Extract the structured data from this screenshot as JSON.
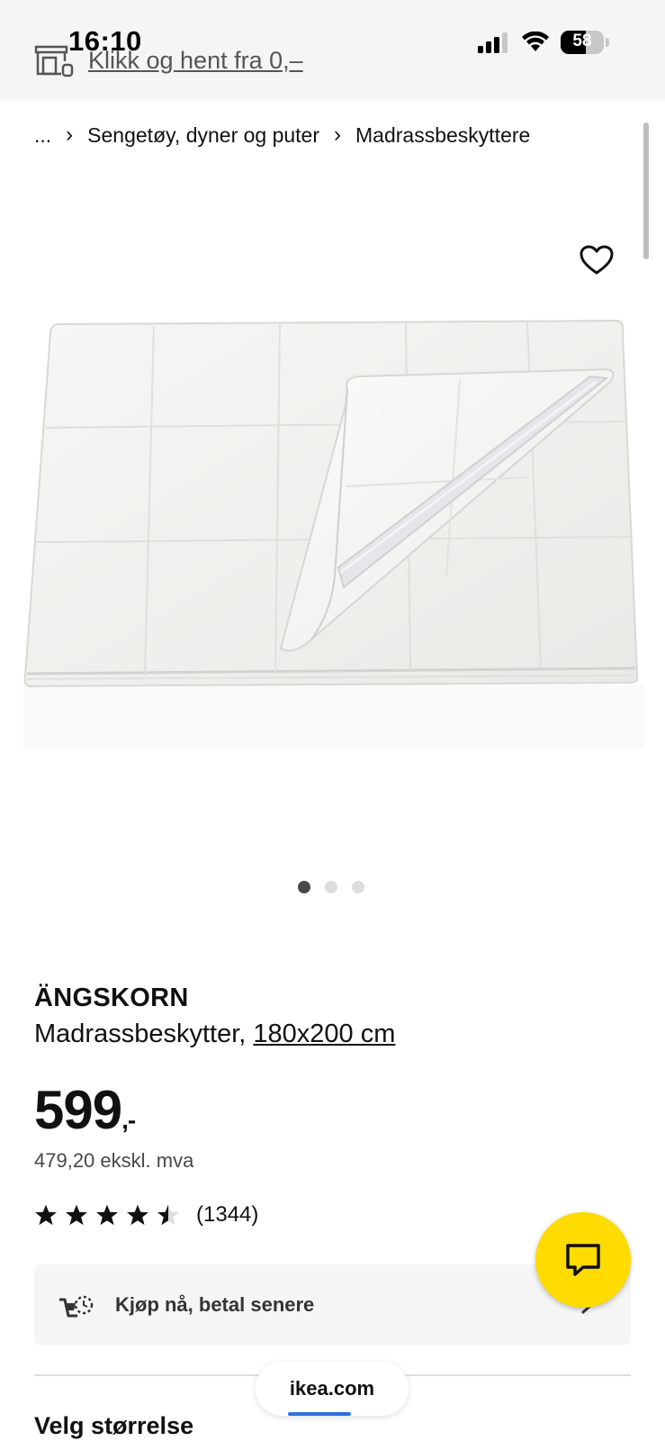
{
  "status_bar": {
    "time": "16:10",
    "battery_level": "58",
    "icons": [
      "cellular-signal-icon",
      "wifi-icon",
      "battery-icon"
    ]
  },
  "store_banner": {
    "icon": "store-icon",
    "link_text": "Klikk og hent fra 0,–"
  },
  "breadcrumb": {
    "items": [
      "...",
      "Sengetøy, dyner og puter",
      "Madrassbeskyttere"
    ],
    "separator_icon": "chevron-right-icon"
  },
  "product": {
    "favorite_icon": "heart-icon",
    "image_icon": "product-image",
    "gallery_count": 3,
    "gallery_active_index": 0,
    "name": "ÄNGSKORN",
    "description": "Madrassbeskytter,",
    "size": "180x200 cm",
    "price": "599",
    "price_suffix": ",-",
    "price_ex_vat": "479,20 ekskl. mva",
    "rating_value": 4.5,
    "rating_max": 5,
    "review_count": "(1344)"
  },
  "payment_option": {
    "icon": "cart-clock-icon",
    "label": "Kjøp nå, betal senere",
    "chevron_icon": "chevron-right-icon"
  },
  "size_section": {
    "title": "Velg størrelse"
  },
  "chat": {
    "icon": "chat-bubble-icon",
    "color": "#FFDB00"
  },
  "browser": {
    "url": "ikea.com",
    "progress_color": "#2F6FE0"
  },
  "colors": {
    "topbar_bg": "#F5F5F5",
    "text": "#111111",
    "muted_text": "#484848",
    "card_bg": "#F5F5F5"
  }
}
